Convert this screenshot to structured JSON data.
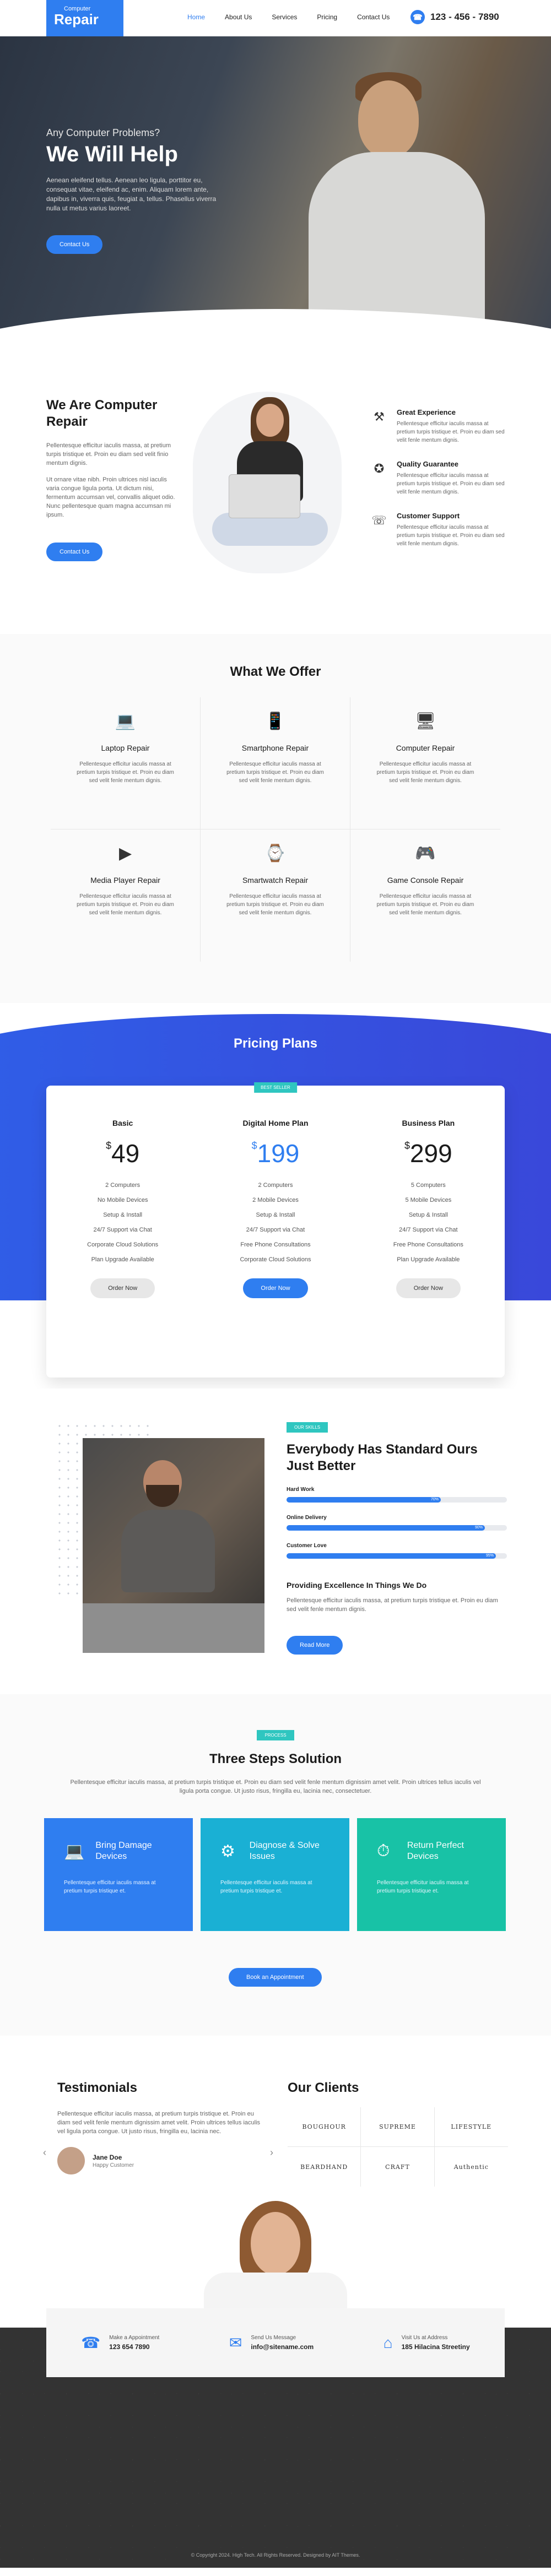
{
  "header": {
    "logo_small": "Computer",
    "logo_big": "Repair",
    "nav": [
      "Home",
      "About Us",
      "Services",
      "Pricing",
      "Contact Us"
    ],
    "phone": "123 - 456 - 7890"
  },
  "hero": {
    "subtitle": "Any Computer Problems?",
    "title": "We Will Help",
    "desc": "Aenean eleifend tellus. Aenean leo ligula, porttitor eu, consequat vitae, eleifend ac, enim. Aliquam lorem ante, dapibus in, viverra quis, feugiat a, tellus. Phasellus viverra nulla ut metus varius laoreet.",
    "button": "Contact Us"
  },
  "about": {
    "title": "We Are Computer Repair",
    "p1": "Pellentesque efficitur iaculis massa, at pretium turpis tristique et. Proin eu diam sed velit finio mentum dignis.",
    "p2": "Ut ornare vitae nibh. Proin ultrices nisl iaculis varia congue ligula porta. Ut dictum nisi, fermentum accumsan vel, convallis aliquet odio. Nunc pellentesque quam magna accumsan mi ipsum.",
    "button": "Contact Us",
    "features": [
      {
        "icon": "tools-icon",
        "title": "Great Experience",
        "text": "Pellentesque efficitur iaculis massa at pretium turpis tristique et. Proin eu diam sed velit fenle mentum dignis."
      },
      {
        "icon": "badge-icon",
        "title": "Quality Guarantee",
        "text": "Pellentesque efficitur iaculis massa at pretium turpis tristique et. Proin eu diam sed velit fenle mentum dignis."
      },
      {
        "icon": "headset-icon",
        "title": "Customer Support",
        "text": "Pellentesque efficitur iaculis massa at pretium turpis tristique et. Proin eu diam sed velit fenle mentum dignis."
      }
    ]
  },
  "services": {
    "title": "What We Offer",
    "items": [
      {
        "icon": "laptop-icon",
        "title": "Laptop Repair",
        "text": "Pellentesque efficitur iaculis massa at pretium turpis tristique et. Proin eu diam sed velit fenle mentum dignis."
      },
      {
        "icon": "smartphone-icon",
        "title": "Smartphone Repair",
        "text": "Pellentesque efficitur iaculis massa at pretium turpis tristique et. Proin eu diam sed velit fenle mentum dignis."
      },
      {
        "icon": "monitor-icon",
        "title": "Computer Repair",
        "text": "Pellentesque efficitur iaculis massa at pretium turpis tristique et. Proin eu diam sed velit fenle mentum dignis."
      },
      {
        "icon": "media-player-icon",
        "title": "Media Player Repair",
        "text": "Pellentesque efficitur iaculis massa at pretium turpis tristique et. Proin eu diam sed velit fenle mentum dignis."
      },
      {
        "icon": "smartwatch-icon",
        "title": "Smartwatch Repair",
        "text": "Pellentesque efficitur iaculis massa at pretium turpis tristique et. Proin eu diam sed velit fenle mentum dignis."
      },
      {
        "icon": "gamepad-icon",
        "title": "Game Console Repair",
        "text": "Pellentesque efficitur iaculis massa at pretium turpis tristique et. Proin eu diam sed velit fenle mentum dignis."
      }
    ]
  },
  "pricing": {
    "title": "Pricing Plans",
    "plans": [
      {
        "name": "Basic",
        "price": "49",
        "badge": "",
        "features": [
          "2 Computers",
          "No Mobile Devices",
          "Setup & Install",
          "24/7 Support via Chat",
          "Corporate Cloud Solutions",
          "Plan Upgrade Available"
        ],
        "button": "Order Now"
      },
      {
        "name": "Digital Home Plan",
        "price": "199",
        "badge": "BEST SELLER",
        "features": [
          "2 Computers",
          "2 Mobile Devices",
          "Setup & Install",
          "24/7 Support via Chat",
          "Free Phone Consultations",
          "Corporate Cloud Solutions"
        ],
        "button": "Order Now"
      },
      {
        "name": "Business Plan",
        "price": "299",
        "badge": "",
        "features": [
          "5 Computers",
          "5 Mobile Devices",
          "Setup & Install",
          "24/7 Support via Chat",
          "Free Phone Consultations",
          "Plan Upgrade Available"
        ],
        "button": "Order Now"
      }
    ]
  },
  "skills": {
    "tag": "OUR SKILLS",
    "title": "Everybody Has Standard Ours Just Better",
    "bars": [
      {
        "label": "Hard Work",
        "pct": "70%"
      },
      {
        "label": "Online Delivery",
        "pct": "90%"
      },
      {
        "label": "Customer Love",
        "pct": "95%"
      }
    ],
    "subtitle": "Providing Excellence In Things We Do",
    "text": "Pellentesque efficitur iaculis massa, at pretium turpis tristique et. Proin eu diam sed velit fenle mentum dignis.",
    "button": "Read More"
  },
  "process": {
    "tag": "PROCESS",
    "title": "Three Steps Solution",
    "text": "Pellentesque efficitur iaculis massa, at pretium turpis tristique et. Proin eu diam sed velit fenle mentum dignissim amet velit. Proin ultrices tellus iaculis vel ligula porta congue. Ut justo risus, fringilla eu, lacinia nec, consectetuer.",
    "steps": [
      {
        "icon": "devices-icon",
        "title": "Bring Damage Devices",
        "text": "Pellentesque efficitur iaculis massa at pretium turpis tristique et.",
        "color": "#2f7ef0"
      },
      {
        "icon": "diagnose-icon",
        "title": "Diagnose & Solve Issues",
        "text": "Pellentesque efficitur iaculis massa at pretium turpis tristique et.",
        "color": "#1ab0d4"
      },
      {
        "icon": "stopwatch-icon",
        "title": "Return Perfect Devices",
        "text": "Pellentesque efficitur iaculis massa at pretium turpis tristique et.",
        "color": "#18c2a6"
      }
    ],
    "button": "Book an Appointment"
  },
  "testimonials": {
    "title": "Testimonials",
    "text": "Pellentesque efficitur iaculis massa, at pretium turpis tristique et. Proin eu diam sed velit fenle mentum dignissim amet velit. Proin ultrices tellus iaculis vel ligula porta congue. Ut justo risus, fringilla eu, lacinia nec.",
    "name": "Jane Doe",
    "role": "Happy Customer"
  },
  "clients": {
    "title": "Our Clients",
    "logos": [
      "BOUGHOUR",
      "SUPREME",
      "LIFESTYLE",
      "BEARDHAND",
      "CRAFT",
      "Authentic"
    ]
  },
  "contact": {
    "items": [
      {
        "icon": "phone-icon",
        "label": "Make a Appointment",
        "value": "123 654 7890"
      },
      {
        "icon": "mail-icon",
        "label": "Send Us Message",
        "value": "info@sitename.com"
      },
      {
        "icon": "map-pin-icon",
        "label": "Visit Us at Address",
        "value": "185 Hilacina Streetiny"
      }
    ],
    "copyright": "© Copyright 2024. High Tech. All Rights Reserved. Designed by AIT Themes."
  }
}
